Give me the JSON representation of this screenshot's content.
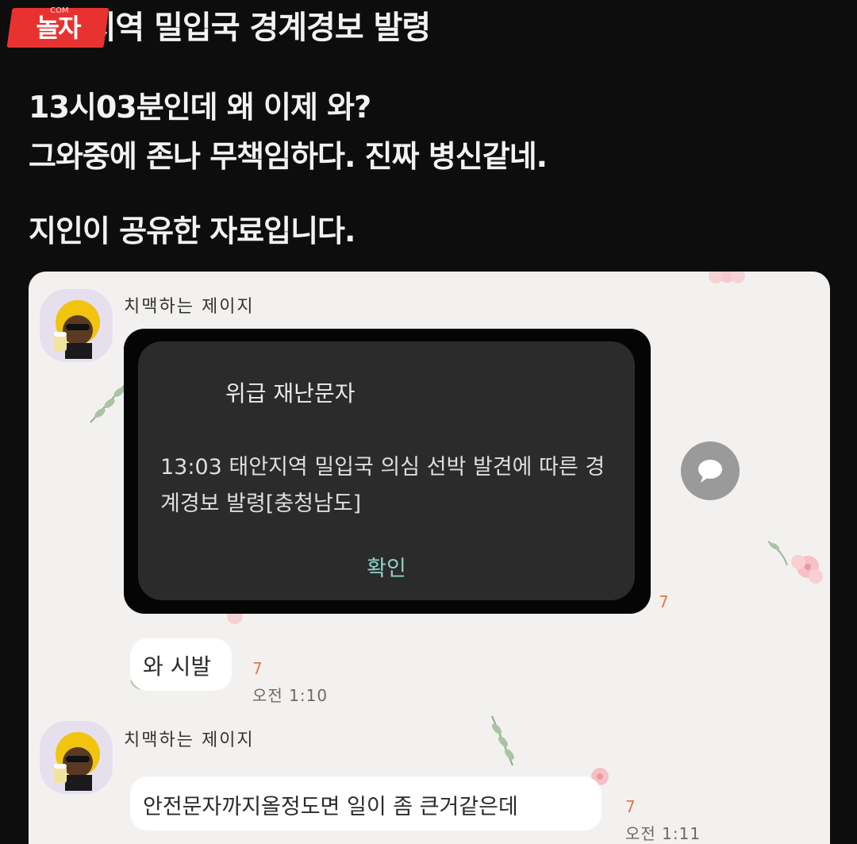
{
  "post": {
    "title": "태안지역 밀입국 경계경보 발령",
    "logo_text": "놀자",
    "logo_small": "COM",
    "line1": "13시03분인데 왜 이제 와?",
    "line2": "그와중에 존나 무책임하다. 진짜 병신같네.",
    "line3": "지인이 공유한 자료입니다."
  },
  "chat": {
    "messages": [
      {
        "sender": "치맥하는 제이지",
        "alert": {
          "title": "위급 재난문자",
          "body": "13:03 태안지역 밀입국 의심 선박 발견에 따른 경계경보 발령[충청남도]",
          "ok_label": "확인"
        },
        "unread": "7"
      },
      {
        "text": "와 시발",
        "unread": "7",
        "time": "오전 1:10"
      },
      {
        "sender": "치맥하는 제이지",
        "text": "안전문자까지올정도면 일이 좀 큰거같은데",
        "unread": "7",
        "time": "오전 1:11"
      }
    ]
  },
  "icons": [
    "avatar-character",
    "share-icon",
    "flower-decoration",
    "leaf-decoration"
  ],
  "colors": {
    "background": "#0d0d0d",
    "chat_background": "#f3f1ef",
    "alert_card": "#2b2b2b",
    "alert_ok": "#8fd1c7",
    "unread": "#e07a4a",
    "logo": "#e8322f"
  }
}
